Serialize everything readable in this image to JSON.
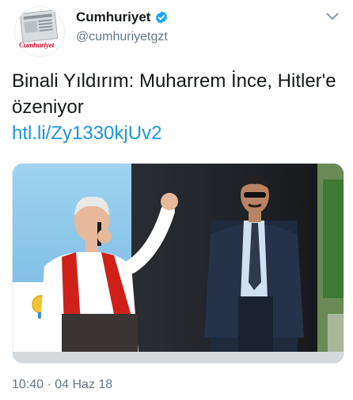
{
  "account": {
    "name": "Cumhuriyet",
    "handle": "@cumhuriyetgzt",
    "avatar_text": "Cumhuriyet",
    "verified": true
  },
  "tweet": {
    "text": "Binali Yıldırım: Muharrem İnce, Hitler'e özeniyor",
    "link": "htl.li/Zy1330kjUv2"
  },
  "meta": {
    "timestamp": "10:40 · 04 Haz 18"
  },
  "colors": {
    "link": "#1b95e0",
    "verified": "#1da1f2",
    "muted": "#657786",
    "scarf": "#d0201a",
    "sky": "#8ec9ec"
  },
  "icons": [
    "verified-badge-icon",
    "chevron-down-icon"
  ]
}
